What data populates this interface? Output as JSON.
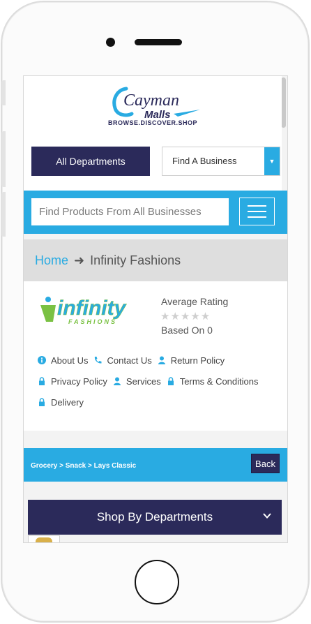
{
  "header": {
    "logo_text_1": "Cayman",
    "logo_text_2": "Malls",
    "tagline": "BROWSE.DISCOVER.SHOP"
  },
  "nav": {
    "all_departments": "All Departments",
    "find_business": "Find A Business"
  },
  "search": {
    "placeholder": "Find Products From All Businesses"
  },
  "breadcrumb": {
    "home": "Home",
    "current": "Infinity Fashions"
  },
  "business": {
    "logo_main": "infinity",
    "logo_sub": "FASHIONS",
    "rating_label": "Average Rating",
    "rating_value": 0,
    "stars": "★★★★★",
    "based_on": "Based On 0",
    "links": [
      {
        "label": "About Us",
        "icon": "info-icon"
      },
      {
        "label": "Contact Us",
        "icon": "phone-icon"
      },
      {
        "label": "Return Policy",
        "icon": "user-icon"
      },
      {
        "label": "Privacy Policy",
        "icon": "lock-icon"
      },
      {
        "label": "Services",
        "icon": "user-icon"
      },
      {
        "label": "Terms & Conditions",
        "icon": "lock-icon"
      },
      {
        "label": "Delivery",
        "icon": "lock-icon"
      }
    ]
  },
  "category_bar": {
    "path": "Grocery > Snack > Lays Classic",
    "back": "Back"
  },
  "shop_departments": {
    "label": "Shop By Departments"
  },
  "colors": {
    "accent": "#29abe2",
    "brand": "#2b2a5a",
    "logo_green": "#7ac143"
  }
}
